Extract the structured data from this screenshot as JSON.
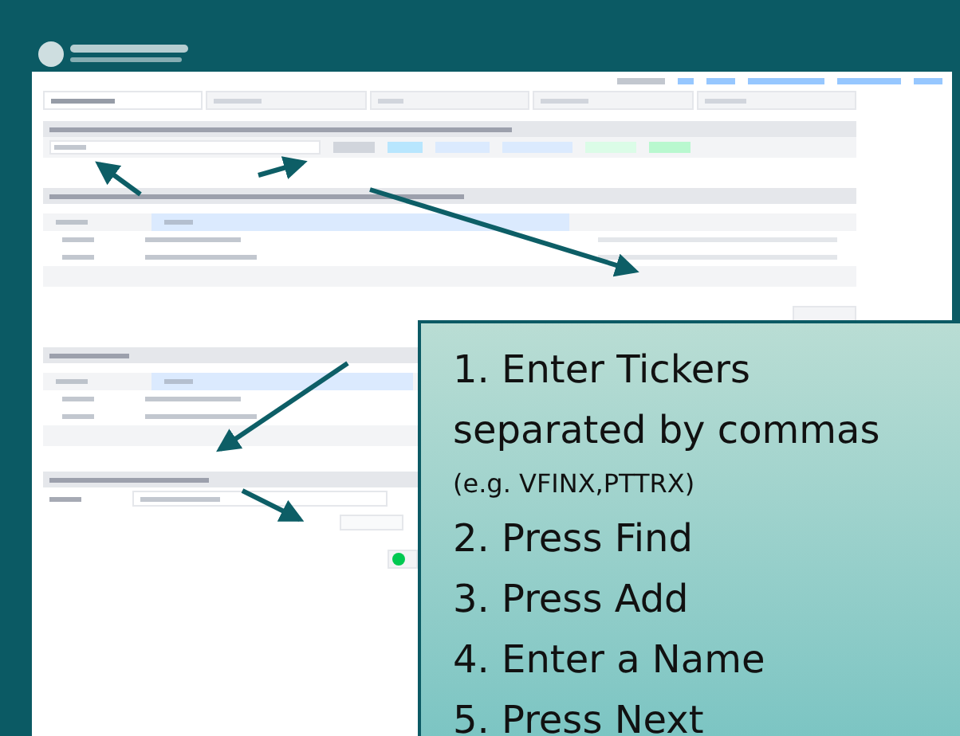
{
  "steps": [
    {
      "selected": true
    },
    {
      "selected": false
    },
    {
      "selected": false
    },
    {
      "selected": false
    },
    {
      "selected": false
    }
  ],
  "callout": {
    "lines": [
      {
        "kind": "step",
        "text": "1. Enter Tickers"
      },
      {
        "kind": "step",
        "text": "separated by commas"
      },
      {
        "kind": "note",
        "text": "(e.g.  VFINX,PTTRX)"
      },
      {
        "kind": "step",
        "text": "2. Press Find"
      },
      {
        "kind": "step",
        "text": "3. Press Add"
      },
      {
        "kind": "step",
        "text": "4. Enter a Name"
      },
      {
        "kind": "step",
        "text": "5. Press Next"
      }
    ]
  }
}
